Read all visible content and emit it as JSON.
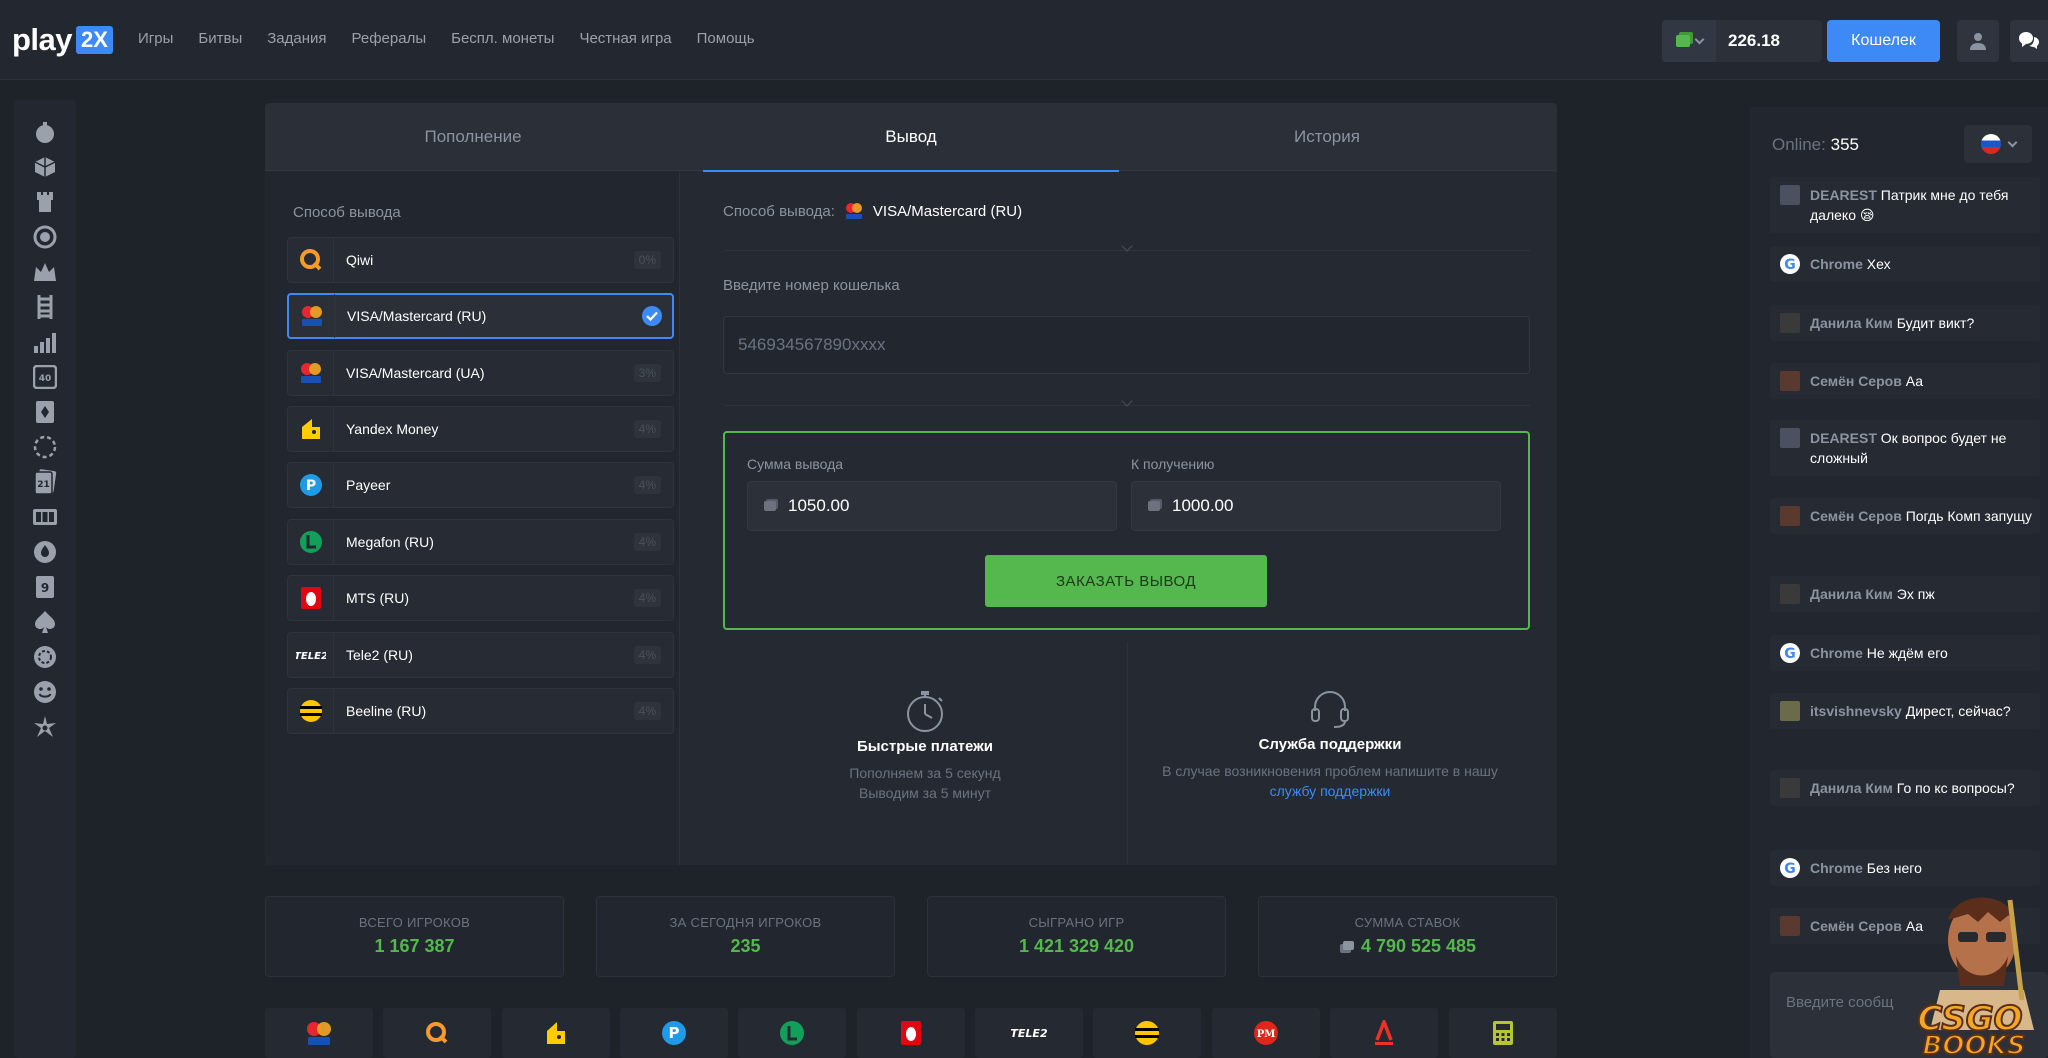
{
  "header": {
    "logo_word": "play",
    "logo_badge": "2X",
    "nav": [
      "Игры",
      "Битвы",
      "Задания",
      "Рефералы",
      "Беспл. монеты",
      "Честная игра",
      "Помощь"
    ],
    "balance": "226.18",
    "wallet_button": "Кошелек"
  },
  "tabs": [
    "Пополнение",
    "Вывод",
    "История"
  ],
  "methods": {
    "title": "Способ вывода",
    "items": [
      {
        "name": "Qiwi",
        "fee": "0%"
      },
      {
        "name": "VISA/Mastercard (RU)",
        "fee": ""
      },
      {
        "name": "VISA/Mastercard (UA)",
        "fee": "3%"
      },
      {
        "name": "Yandex Money",
        "fee": "4%"
      },
      {
        "name": "Payeer",
        "fee": "4%"
      },
      {
        "name": "Megafon (RU)",
        "fee": "4%"
      },
      {
        "name": "MTS (RU)",
        "fee": "4%"
      },
      {
        "name": "Tele2 (RU)",
        "fee": "4%"
      },
      {
        "name": "Beeline (RU)",
        "fee": "4%"
      }
    ]
  },
  "form": {
    "way_label": "Способ вывода:",
    "way_value": "VISA/Mastercard (RU)",
    "wallet_label": "Введите номер кошелька",
    "wallet_placeholder": "546934567890xxxx",
    "sum_label": "Сумма вывода",
    "sum_value": "1050.00",
    "receive_label": "К получению",
    "receive_value": "1000.00",
    "order_button": "ЗАКАЗАТЬ ВЫВОД"
  },
  "features": {
    "fast_title": "Быстрые платежи",
    "fast_line1": "Пополняем за 5 секунд",
    "fast_line2": "Выводим за 5 минут",
    "support_title": "Служба поддержки",
    "support_line1": "В случае возникновения проблем напишите в нашу",
    "support_link": "службу поддержки"
  },
  "stats": [
    {
      "label": "ВСЕГО ИГРОКОВ",
      "value": "1 167 387"
    },
    {
      "label": "ЗА СЕГОДНЯ ИГРОКОВ",
      "value": "235"
    },
    {
      "label": "СЫГРАНО ИГР",
      "value": "1 421 329 420"
    },
    {
      "label": "СУММА СТАВОК",
      "value": "4 790 525 485"
    }
  ],
  "payment_logos": [
    "visa-mastercard",
    "qiwi",
    "yandex",
    "payeer",
    "megafon",
    "mts",
    "tele2",
    "beeline",
    "perfect-money",
    "alfa",
    "terminal"
  ],
  "chat": {
    "online_label": "Online:",
    "online_count": "355",
    "input_placeholder": "Введите сообщ",
    "messages": [
      {
        "name": "DEAREST",
        "text": "Патрик мне до тебя далеко 😪"
      },
      {
        "name": "Chrome",
        "text": "Хех"
      },
      {
        "name": "Данила Ким",
        "text": "Будит викт?"
      },
      {
        "name": "Семён Серов",
        "text": "Аа"
      },
      {
        "name": "DEAREST",
        "text": "Ок вопрос будет не сложный"
      },
      {
        "name": "Семён Серов",
        "text": "Погдь Комп запущу"
      },
      {
        "name": "Данила Ким",
        "text": "Эх пж"
      },
      {
        "name": "Chrome",
        "text": "Не ждём его"
      },
      {
        "name": "itsvishnevsky",
        "text": "Дирест, сейчас?"
      },
      {
        "name": "Данила Ким",
        "text": "Го по кс вопросы?"
      },
      {
        "name": "Chrome",
        "text": "Без него"
      },
      {
        "name": "Семён Серов",
        "text": "Аа"
      }
    ]
  },
  "watermark": "CSGO BOOKS",
  "colors": {
    "accent": "#3d8af7",
    "green": "#54b84e",
    "bg": "#1e2229"
  }
}
